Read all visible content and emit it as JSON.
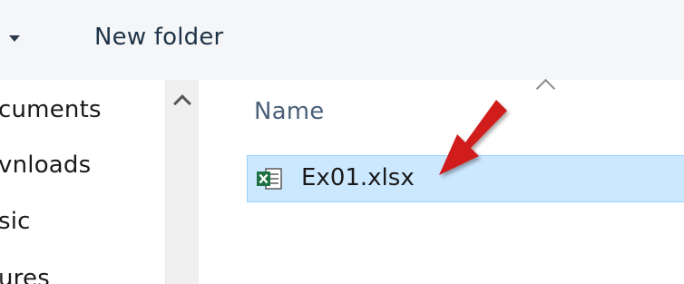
{
  "toolbar": {
    "new_folder_label": "New folder"
  },
  "nav": {
    "items": [
      {
        "label": "cuments"
      },
      {
        "label": "vnloads"
      },
      {
        "label": "sic"
      },
      {
        "label": "ures"
      }
    ]
  },
  "content": {
    "column_header": "Name",
    "files": [
      {
        "name": "Ex01.xlsx",
        "icon": "excel-file-icon",
        "selected": true
      }
    ]
  },
  "colors": {
    "selection_bg": "#cce8ff",
    "selection_border": "#99d1ff",
    "annotation_arrow": "#d11f1f",
    "excel_green": "#1e7145"
  }
}
